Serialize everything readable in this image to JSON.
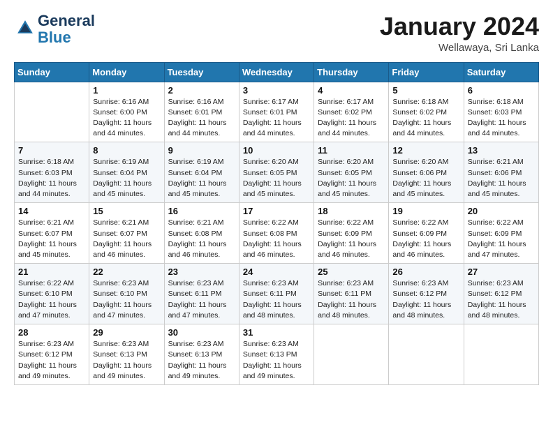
{
  "logo": {
    "line1": "General",
    "line2": "Blue"
  },
  "title": "January 2024",
  "location": "Wellawaya, Sri Lanka",
  "days_header": [
    "Sunday",
    "Monday",
    "Tuesday",
    "Wednesday",
    "Thursday",
    "Friday",
    "Saturday"
  ],
  "weeks": [
    [
      {
        "num": "",
        "sunrise": "",
        "sunset": "",
        "daylight": ""
      },
      {
        "num": "1",
        "sunrise": "Sunrise: 6:16 AM",
        "sunset": "Sunset: 6:00 PM",
        "daylight": "Daylight: 11 hours and 44 minutes."
      },
      {
        "num": "2",
        "sunrise": "Sunrise: 6:16 AM",
        "sunset": "Sunset: 6:01 PM",
        "daylight": "Daylight: 11 hours and 44 minutes."
      },
      {
        "num": "3",
        "sunrise": "Sunrise: 6:17 AM",
        "sunset": "Sunset: 6:01 PM",
        "daylight": "Daylight: 11 hours and 44 minutes."
      },
      {
        "num": "4",
        "sunrise": "Sunrise: 6:17 AM",
        "sunset": "Sunset: 6:02 PM",
        "daylight": "Daylight: 11 hours and 44 minutes."
      },
      {
        "num": "5",
        "sunrise": "Sunrise: 6:18 AM",
        "sunset": "Sunset: 6:02 PM",
        "daylight": "Daylight: 11 hours and 44 minutes."
      },
      {
        "num": "6",
        "sunrise": "Sunrise: 6:18 AM",
        "sunset": "Sunset: 6:03 PM",
        "daylight": "Daylight: 11 hours and 44 minutes."
      }
    ],
    [
      {
        "num": "7",
        "sunrise": "Sunrise: 6:18 AM",
        "sunset": "Sunset: 6:03 PM",
        "daylight": "Daylight: 11 hours and 44 minutes."
      },
      {
        "num": "8",
        "sunrise": "Sunrise: 6:19 AM",
        "sunset": "Sunset: 6:04 PM",
        "daylight": "Daylight: 11 hours and 45 minutes."
      },
      {
        "num": "9",
        "sunrise": "Sunrise: 6:19 AM",
        "sunset": "Sunset: 6:04 PM",
        "daylight": "Daylight: 11 hours and 45 minutes."
      },
      {
        "num": "10",
        "sunrise": "Sunrise: 6:20 AM",
        "sunset": "Sunset: 6:05 PM",
        "daylight": "Daylight: 11 hours and 45 minutes."
      },
      {
        "num": "11",
        "sunrise": "Sunrise: 6:20 AM",
        "sunset": "Sunset: 6:05 PM",
        "daylight": "Daylight: 11 hours and 45 minutes."
      },
      {
        "num": "12",
        "sunrise": "Sunrise: 6:20 AM",
        "sunset": "Sunset: 6:06 PM",
        "daylight": "Daylight: 11 hours and 45 minutes."
      },
      {
        "num": "13",
        "sunrise": "Sunrise: 6:21 AM",
        "sunset": "Sunset: 6:06 PM",
        "daylight": "Daylight: 11 hours and 45 minutes."
      }
    ],
    [
      {
        "num": "14",
        "sunrise": "Sunrise: 6:21 AM",
        "sunset": "Sunset: 6:07 PM",
        "daylight": "Daylight: 11 hours and 45 minutes."
      },
      {
        "num": "15",
        "sunrise": "Sunrise: 6:21 AM",
        "sunset": "Sunset: 6:07 PM",
        "daylight": "Daylight: 11 hours and 46 minutes."
      },
      {
        "num": "16",
        "sunrise": "Sunrise: 6:21 AM",
        "sunset": "Sunset: 6:08 PM",
        "daylight": "Daylight: 11 hours and 46 minutes."
      },
      {
        "num": "17",
        "sunrise": "Sunrise: 6:22 AM",
        "sunset": "Sunset: 6:08 PM",
        "daylight": "Daylight: 11 hours and 46 minutes."
      },
      {
        "num": "18",
        "sunrise": "Sunrise: 6:22 AM",
        "sunset": "Sunset: 6:09 PM",
        "daylight": "Daylight: 11 hours and 46 minutes."
      },
      {
        "num": "19",
        "sunrise": "Sunrise: 6:22 AM",
        "sunset": "Sunset: 6:09 PM",
        "daylight": "Daylight: 11 hours and 46 minutes."
      },
      {
        "num": "20",
        "sunrise": "Sunrise: 6:22 AM",
        "sunset": "Sunset: 6:09 PM",
        "daylight": "Daylight: 11 hours and 47 minutes."
      }
    ],
    [
      {
        "num": "21",
        "sunrise": "Sunrise: 6:22 AM",
        "sunset": "Sunset: 6:10 PM",
        "daylight": "Daylight: 11 hours and 47 minutes."
      },
      {
        "num": "22",
        "sunrise": "Sunrise: 6:23 AM",
        "sunset": "Sunset: 6:10 PM",
        "daylight": "Daylight: 11 hours and 47 minutes."
      },
      {
        "num": "23",
        "sunrise": "Sunrise: 6:23 AM",
        "sunset": "Sunset: 6:11 PM",
        "daylight": "Daylight: 11 hours and 47 minutes."
      },
      {
        "num": "24",
        "sunrise": "Sunrise: 6:23 AM",
        "sunset": "Sunset: 6:11 PM",
        "daylight": "Daylight: 11 hours and 48 minutes."
      },
      {
        "num": "25",
        "sunrise": "Sunrise: 6:23 AM",
        "sunset": "Sunset: 6:11 PM",
        "daylight": "Daylight: 11 hours and 48 minutes."
      },
      {
        "num": "26",
        "sunrise": "Sunrise: 6:23 AM",
        "sunset": "Sunset: 6:12 PM",
        "daylight": "Daylight: 11 hours and 48 minutes."
      },
      {
        "num": "27",
        "sunrise": "Sunrise: 6:23 AM",
        "sunset": "Sunset: 6:12 PM",
        "daylight": "Daylight: 11 hours and 48 minutes."
      }
    ],
    [
      {
        "num": "28",
        "sunrise": "Sunrise: 6:23 AM",
        "sunset": "Sunset: 6:12 PM",
        "daylight": "Daylight: 11 hours and 49 minutes."
      },
      {
        "num": "29",
        "sunrise": "Sunrise: 6:23 AM",
        "sunset": "Sunset: 6:13 PM",
        "daylight": "Daylight: 11 hours and 49 minutes."
      },
      {
        "num": "30",
        "sunrise": "Sunrise: 6:23 AM",
        "sunset": "Sunset: 6:13 PM",
        "daylight": "Daylight: 11 hours and 49 minutes."
      },
      {
        "num": "31",
        "sunrise": "Sunrise: 6:23 AM",
        "sunset": "Sunset: 6:13 PM",
        "daylight": "Daylight: 11 hours and 49 minutes."
      },
      {
        "num": "",
        "sunrise": "",
        "sunset": "",
        "daylight": ""
      },
      {
        "num": "",
        "sunrise": "",
        "sunset": "",
        "daylight": ""
      },
      {
        "num": "",
        "sunrise": "",
        "sunset": "",
        "daylight": ""
      }
    ]
  ]
}
